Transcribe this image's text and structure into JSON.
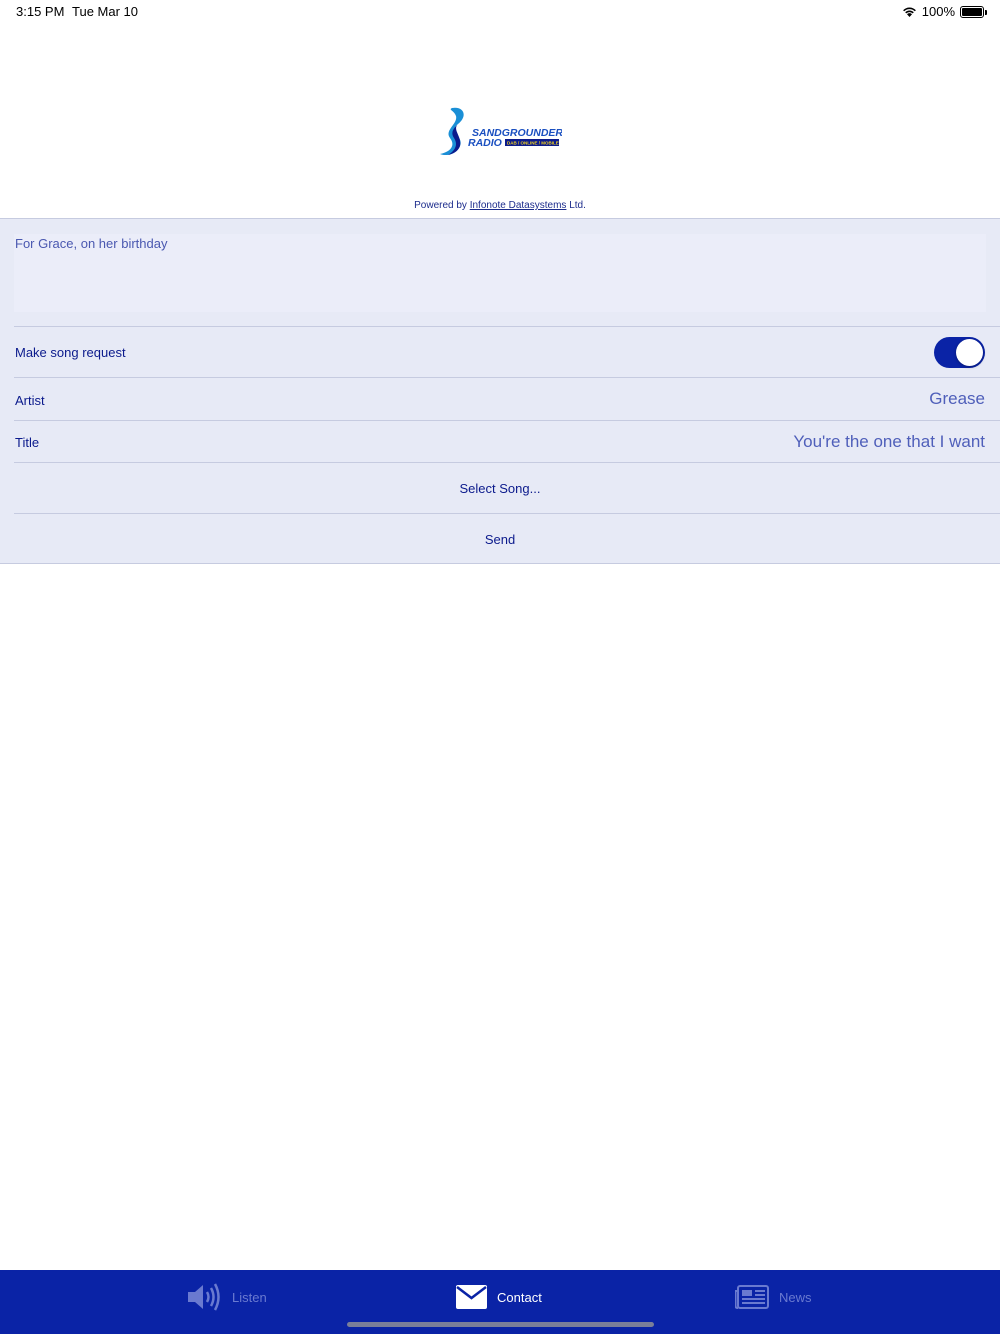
{
  "status_bar": {
    "time": "3:15 PM",
    "date": "Tue Mar 10",
    "battery_text": "100%",
    "wifi_icon": "wifi-icon",
    "battery_icon": "battery-icon"
  },
  "header": {
    "logo_line1": "SANDGROUNDER",
    "logo_line2": "RADIO",
    "logo_tagline": "DAB / ONLINE / MOBILE",
    "powered_prefix": "Powered by ",
    "powered_link": "Infonote Datasystems",
    "powered_suffix": " Ltd."
  },
  "form": {
    "message_text": "For Grace, on her birthday",
    "song_request_label": "Make song request",
    "song_request_on": true,
    "artist_label": "Artist",
    "artist_value": "Grease",
    "title_label": "Title",
    "title_value": "You're the one that I want",
    "select_song_label": "Select Song...",
    "send_label": "Send"
  },
  "tabbar": {
    "tabs": [
      {
        "label": "Listen",
        "icon": "speaker-icon",
        "selected": false
      },
      {
        "label": "Contact",
        "icon": "envelope-icon",
        "selected": true
      },
      {
        "label": "News",
        "icon": "newspaper-icon",
        "selected": false
      }
    ]
  },
  "colors": {
    "accent": "#0a23a6",
    "form_background": "#e7eaf6",
    "text_primary": "#0b1a8c",
    "text_secondary": "#4f5fba",
    "tab_inactive": "#6a7ad0"
  }
}
